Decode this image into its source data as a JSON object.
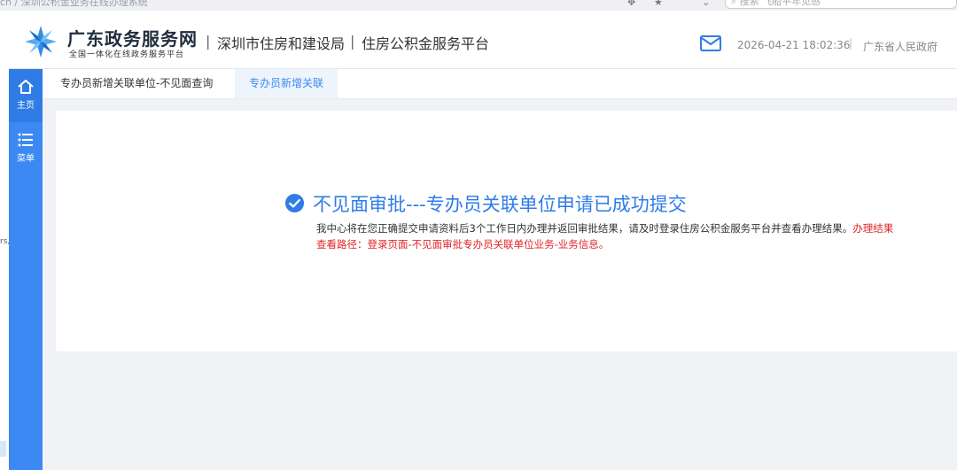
{
  "browser": {
    "url_fragment": "cn / 深圳公积金业务在线办理系统",
    "search_placeholder": "搜索 飞船平年见感"
  },
  "header": {
    "brand_title": "广东政务服务网",
    "brand_subtitle": "全国一体化在线政务服务平台",
    "dept_1": "深圳市住房和建设局",
    "dept_2": "住房公积金服务平台",
    "datetime": "2026-04-21 18:02:36",
    "gov_link": "广东省人民政府",
    "separator": "|"
  },
  "sidenav": {
    "home_label": "主页",
    "menu_label": "菜单"
  },
  "tabs": [
    {
      "label": "专办员新增关联单位-不见面查询"
    },
    {
      "label": "专办员新增关联"
    }
  ],
  "result": {
    "title": "不见面审批---专办员关联单位申请已成功提交",
    "message": "我中心将在您正确提交申请资料后3个工作日内办理并返回审批结果，请及时登录住房公积金服务平台并查看办理结果。",
    "message_red": "办理结果查看路径：登录页面-不见面审批专办员关联单位业务-业务信息。"
  },
  "left_fragment": "rs,",
  "colors": {
    "accent": "#3c89f3",
    "alert_red": "#e02424",
    "background": "#f0f2f5"
  }
}
